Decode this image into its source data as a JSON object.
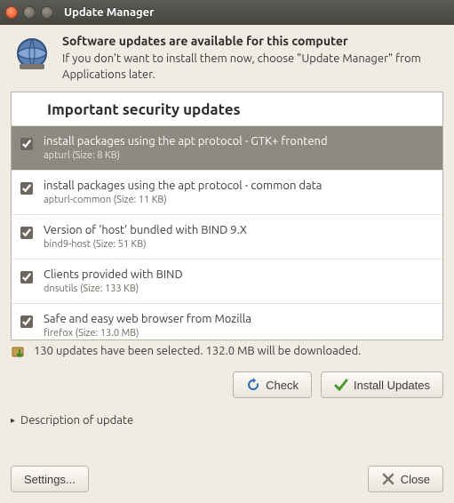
{
  "window": {
    "title": "Update Manager"
  },
  "header": {
    "headline": "Software updates are available for this computer",
    "subline": "If you don't want to install them now, choose \"Update Manager\" from Applications later."
  },
  "list": {
    "section_title": "Important security updates",
    "items": [
      {
        "title": "install packages using the apt protocol - GTK+ frontend",
        "sub": "apturl (Size: 8 KB)",
        "checked": true,
        "selected": true
      },
      {
        "title": "install packages using the apt protocol - common data",
        "sub": "apturl-common (Size: 11 KB)",
        "checked": true,
        "selected": false
      },
      {
        "title": "Version of 'host' bundled with BIND 9.X",
        "sub": "bind9-host (Size: 51 KB)",
        "checked": true,
        "selected": false
      },
      {
        "title": "Clients provided with BIND",
        "sub": "dnsutils (Size: 133 KB)",
        "checked": true,
        "selected": false
      },
      {
        "title": "Safe and easy web browser from Mozilla",
        "sub": "firefox (Size: 13.0 MB)",
        "checked": true,
        "selected": false
      }
    ]
  },
  "status": {
    "text": "130 updates have been selected. 132.0 MB will be downloaded."
  },
  "buttons": {
    "check": "Check",
    "install": "Install Updates",
    "settings": "Settings...",
    "close": "Close"
  },
  "disclosure": {
    "label": "Description of update"
  }
}
